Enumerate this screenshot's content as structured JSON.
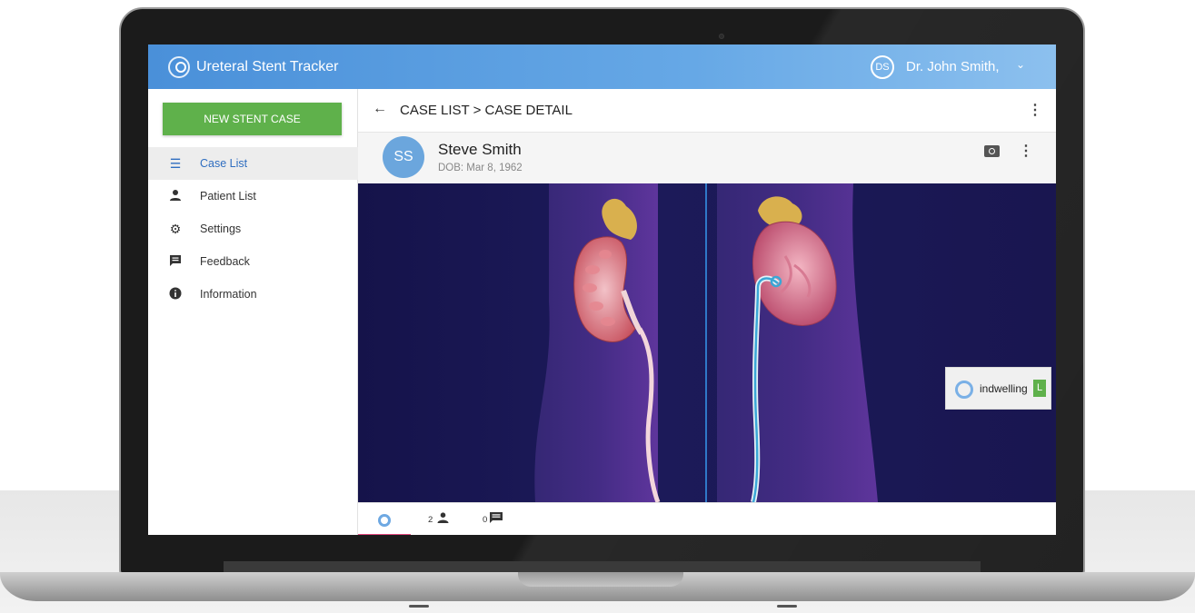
{
  "app": {
    "title": "Ureteral Stent Tracker",
    "user_initials": "DS",
    "user_name": "Dr. John Smith,",
    "user_chevron": "⌄"
  },
  "sidebar": {
    "new_case_label": "NEW STENT CASE",
    "items": [
      {
        "label": "Case List",
        "icon": "list-icon",
        "glyph": "☰",
        "active": true
      },
      {
        "label": "Patient List",
        "icon": "person-icon",
        "glyph": "👤",
        "active": false
      },
      {
        "label": "Settings",
        "icon": "gear-icon",
        "glyph": "⚙",
        "active": false
      },
      {
        "label": "Feedback",
        "icon": "feedback-icon",
        "glyph": "▤",
        "active": false
      },
      {
        "label": "Information",
        "icon": "info-icon",
        "glyph": "ℹ",
        "active": false
      }
    ]
  },
  "breadcrumb": {
    "back_glyph": "←",
    "text": "CASE LIST > CASE DETAIL"
  },
  "patient": {
    "initials": "SS",
    "name": "Steve Smith",
    "dob": "DOB: Mar 8, 1962"
  },
  "stent_tag": {
    "label": "indwelling",
    "badge": "L"
  },
  "tabs": [
    {
      "icon": "stent-logo-icon",
      "count": ""
    },
    {
      "icon": "person-icon",
      "count": "2"
    },
    {
      "icon": "message-icon",
      "count": "0"
    }
  ],
  "colors": {
    "appbar": "#4a90d9",
    "primary_button": "#5fb14b",
    "active_nav": "#2f6ec0",
    "tab_indicator": "#e0457b",
    "illustration_bg": "#1c1a5a"
  }
}
